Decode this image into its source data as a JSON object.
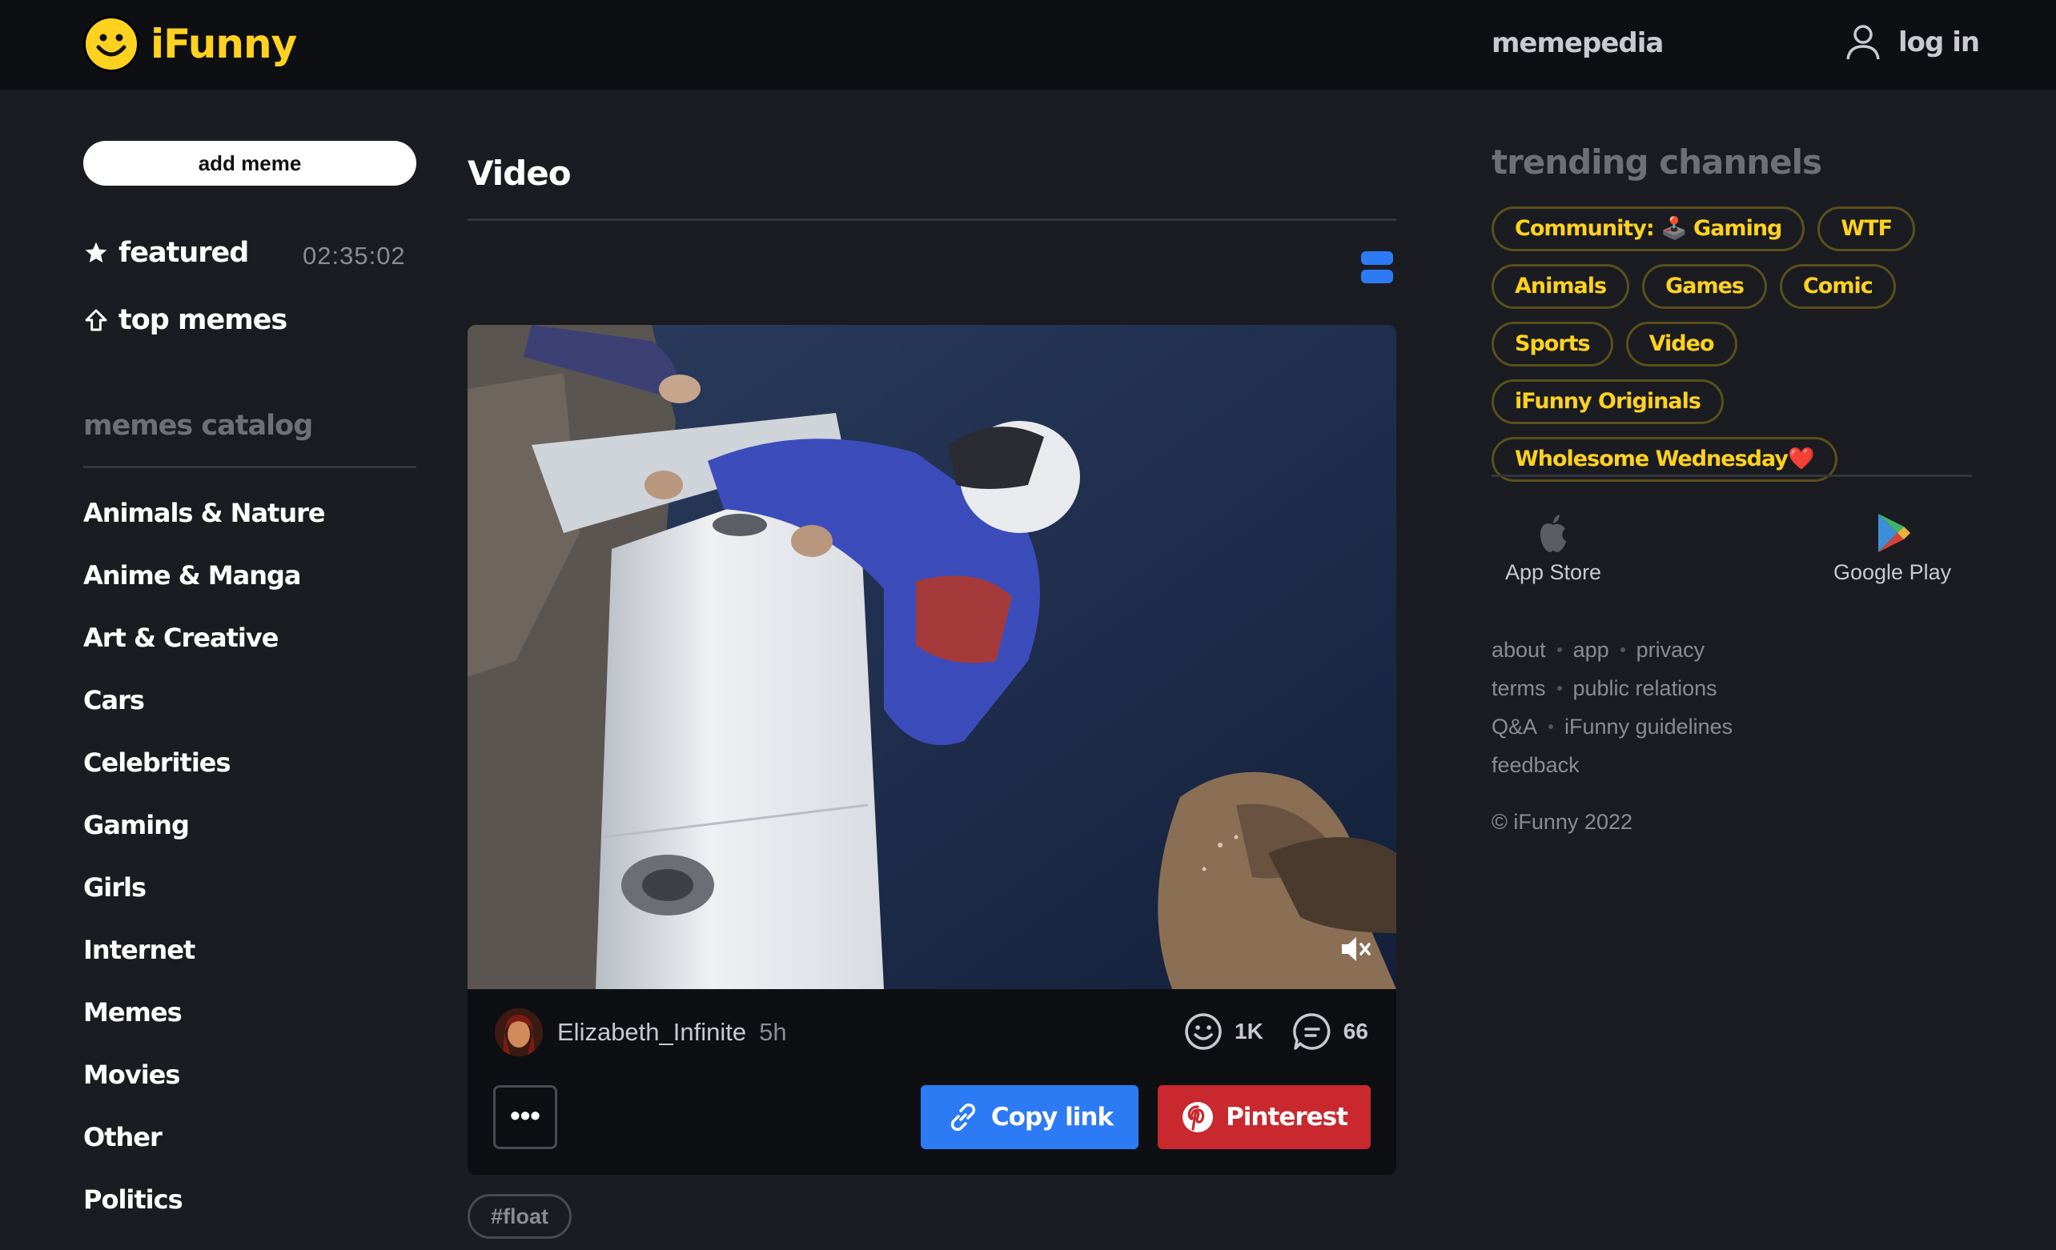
{
  "header": {
    "logo_text": "iFunny",
    "memepedia": "memepedia",
    "login": "log in"
  },
  "sidebar": {
    "add_meme": "add meme",
    "featured": "featured",
    "timer": "02:35:02",
    "top_memes": "top memes",
    "catalog_title": "memes catalog",
    "catalog": [
      "Animals & Nature",
      "Anime & Manga",
      "Art & Creative",
      "Cars",
      "Celebrities",
      "Gaming",
      "Girls",
      "Internet",
      "Memes",
      "Movies",
      "Other",
      "Politics"
    ]
  },
  "main": {
    "title": "Video",
    "post": {
      "author": "Elizabeth_Infinite",
      "time": "5h",
      "smiles": "1K",
      "comments": "66",
      "more": "•••",
      "copy_link": "Copy link",
      "pinterest": "Pinterest"
    },
    "tag": "#float"
  },
  "right": {
    "trending_title": "trending channels",
    "channels": [
      "Community: 🕹️ Gaming",
      "WTF",
      "Animals",
      "Games",
      "Comic",
      "Sports",
      "Video",
      "iFunny Originals",
      "Wholesome Wednesday❤️"
    ],
    "app_store": "App Store",
    "google_play": "Google Play",
    "links": {
      "about": "about",
      "app": "app",
      "privacy": "privacy",
      "terms": "terms",
      "public_relations": "public relations",
      "qa": "Q&A",
      "guidelines": "iFunny guidelines",
      "feedback": "feedback"
    },
    "copyright": "© iFunny 2022"
  },
  "colors": {
    "accent_yellow": "#ffd21f",
    "button_blue": "#2d7bf4",
    "pinterest_red": "#c8282e",
    "background": "#1b1c21",
    "header_bg": "#0e0f13"
  }
}
